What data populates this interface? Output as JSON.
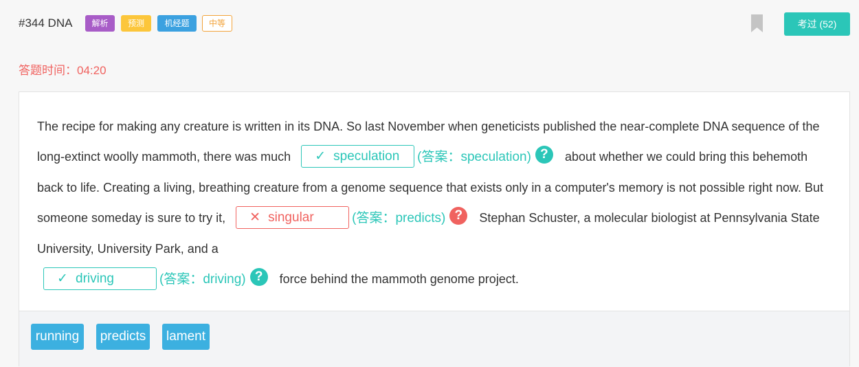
{
  "header": {
    "title": "#344 DNA",
    "tags": [
      "解析",
      "预测",
      "机经题",
      "中等"
    ],
    "kaoguo_label": "考过 (52)"
  },
  "timer": "答题时间：04:20",
  "passage": {
    "s1": "The recipe for making any creature is written in its DNA. So last November when geneticists published the near-complete DNA sequence of the long-extinct woolly mammoth, there was much",
    "blank1": {
      "mark": "✓",
      "value": "speculation",
      "answer": "(答案：speculation)",
      "status": "correct"
    },
    "s2": "about whether we could bring this behemoth back to life. Creating a living, breathing creature from a genome sequence that exists only in a computer's memory is not possible right now. But someone someday is sure to try it,",
    "blank2": {
      "mark": "✕",
      "value": "singular",
      "answer": "(答案：predicts)",
      "status": "wrong"
    },
    "s3": "Stephan Schuster, a molecular biologist at Pennsylvania State University, University Park, and a",
    "blank3": {
      "mark": "✓",
      "value": "driving",
      "answer": "(答案：driving)",
      "status": "correct"
    },
    "s4": "force behind the mammoth genome project.",
    "help_glyph": "?"
  },
  "options": [
    "running",
    "predicts",
    "lament"
  ],
  "colors": {
    "accent": "#2bc6b8",
    "error": "#f0625f",
    "option": "#3cb0e0"
  }
}
